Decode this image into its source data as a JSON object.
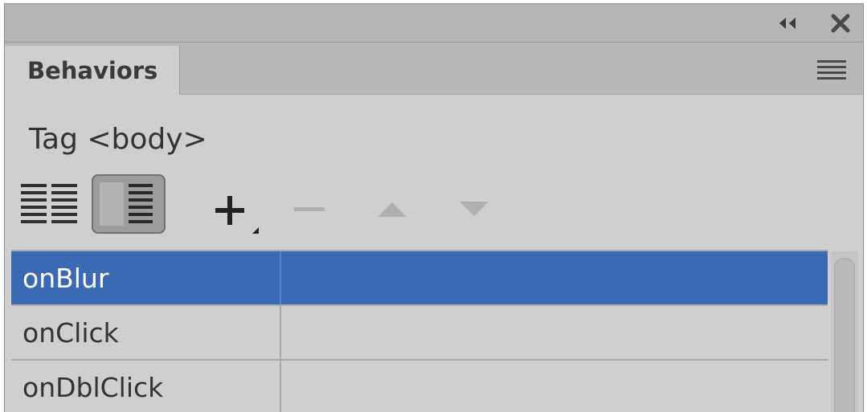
{
  "window": {
    "collapse_icon": "double-chevron-left-icon",
    "close_icon": "close-icon"
  },
  "tabs": [
    {
      "label": "Behaviors",
      "active": true
    }
  ],
  "panel_menu_icon": "hamburger-menu-icon",
  "tag_label": "Tag <body>",
  "toolbar": {
    "show_set_events_icon": "list-columns-icon",
    "show_all_events_icon": "list-detail-icon",
    "show_all_events_active": true,
    "add_behavior_icon": "plus-icon",
    "remove_behavior_icon": "minus-icon",
    "move_up_icon": "triangle-up-icon",
    "move_down_icon": "triangle-down-icon"
  },
  "events": [
    {
      "name": "onBlur",
      "action": "",
      "selected": true
    },
    {
      "name": "onClick",
      "action": "",
      "selected": false
    },
    {
      "name": "onDblClick",
      "action": "",
      "selected": false
    }
  ],
  "colors": {
    "selection": "#3c69b3",
    "panel_bg": "#cfcfcf",
    "titlebar_bg": "#b5b5b5"
  }
}
